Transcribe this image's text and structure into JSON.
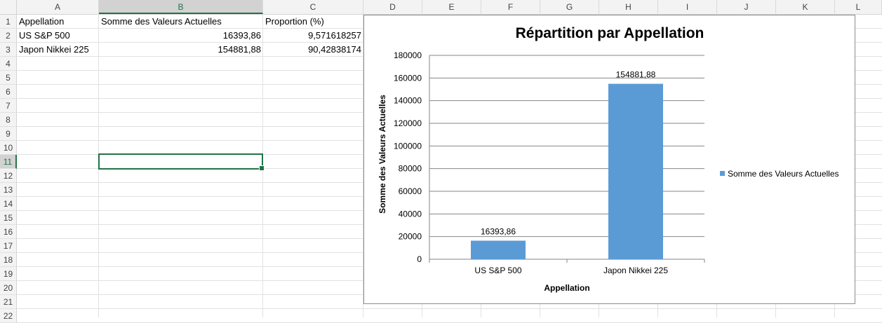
{
  "columns": [
    "A",
    "B",
    "C",
    "D",
    "E",
    "F",
    "G",
    "H",
    "I",
    "J",
    "K",
    "L"
  ],
  "selected_column": "B",
  "rows": [
    "1",
    "2",
    "3",
    "4",
    "5",
    "6",
    "7",
    "8",
    "9",
    "10",
    "11",
    "12",
    "13",
    "14",
    "15",
    "16",
    "17",
    "18",
    "19",
    "20",
    "21",
    "22"
  ],
  "selected_row": "11",
  "table": {
    "headers": [
      "Appellation",
      "Somme des Valeurs Actuelles",
      "Proportion (%)"
    ],
    "rows": [
      [
        "US S&P 500",
        "16393,86",
        "9,571618257"
      ],
      [
        "Japon Nikkei 225",
        "154881,88",
        "90,42838174"
      ]
    ]
  },
  "chart_data": {
    "type": "bar",
    "title": "Répartition par Appellation",
    "xlabel": "Appellation",
    "ylabel": "Somme des Valeurs Actuelles",
    "categories": [
      "US S&P 500",
      "Japon Nikkei 225"
    ],
    "series": [
      {
        "name": "Somme des Valeurs Actuelles",
        "values": [
          16393.86,
          154881.88
        ],
        "labels": [
          "16393,86",
          "154881,88"
        ],
        "color": "#5b9bd5"
      }
    ],
    "ylim": [
      0,
      180000
    ],
    "yticks": [
      "0",
      "20000",
      "40000",
      "60000",
      "80000",
      "100000",
      "120000",
      "140000",
      "160000",
      "180000"
    ],
    "grid": true,
    "legend": "right"
  }
}
